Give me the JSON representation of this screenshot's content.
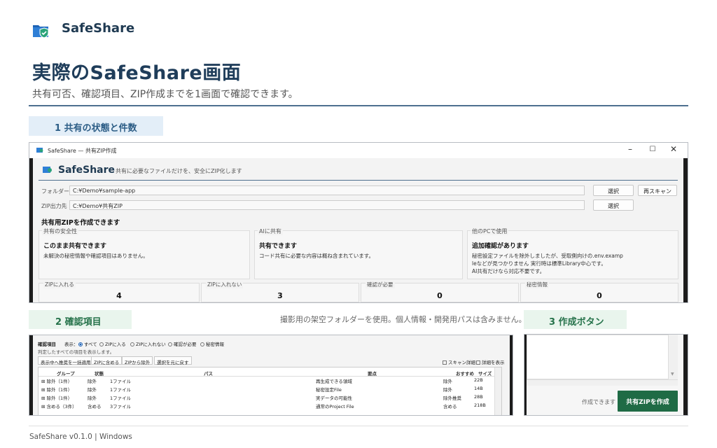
{
  "header": {
    "brand": "SafeShare",
    "title": "実際のSafeShare画面",
    "subtitle": "共有可否、確認項目、ZIP作成までを1画面で確認できます。"
  },
  "sections": {
    "s1": "1  共有の状態と件数",
    "s2": "2  確認項目",
    "s3": "3  作成ボタン",
    "note": "撮影用の架空フォルダーを使用。個人情報・開発用パスは含みません。"
  },
  "window": {
    "title": "SafeShare — 共有ZIP作成",
    "minimize": "–",
    "maximize": "☐",
    "close": "✕"
  },
  "app": {
    "name": "SafeShare",
    "tagline": "共有に必要なファイルだけを、安全にZIP化します",
    "folder_label": "フォルダー",
    "folder_value": "C:¥Demo¥sample-app",
    "output_label": "ZIP出力先",
    "output_value": "C:¥Demo¥共有ZIP",
    "select_label": "選択",
    "select2_label": "選択",
    "rescan_label": "再スキャン",
    "status_heading": "共有用ZIPを作成できます"
  },
  "cards": [
    {
      "header": "共有の安全性",
      "title": "このまま共有できます",
      "desc": "未解決の秘密情報や確認項目はありません。"
    },
    {
      "header": "AIに共有",
      "title": "共有できます",
      "desc": "コード共有に必要な内容は概ね含まれています。"
    },
    {
      "header": "他のPCで使用",
      "title": "追加確認があります",
      "desc": "秘密設定ファイルを除外しましたが、受取側向けの.env.examp\nleなどが見つかりません 実行時は標準Library中心です。\nAI共有だけなら対応不要です。"
    }
  ],
  "stats": [
    {
      "label": "ZIPに入れる",
      "value": "4"
    },
    {
      "label": "ZIPに入れない",
      "value": "3"
    },
    {
      "label": "確認が必要",
      "value": "0"
    },
    {
      "label": "秘密情報",
      "value": "0"
    }
  ],
  "check": {
    "title": "確認項目",
    "display_label": "表示：",
    "filters": [
      "すべて",
      "ZIPに入る",
      "ZIPに入れない",
      "確認が必要",
      "秘密情報"
    ],
    "filter_selected": "すべて",
    "hint": "判定したすべての項目を表示します。",
    "buttons": [
      "表示中へ推奨を一括適用",
      "ZIPに含める",
      "ZIPから除外",
      "選択を元に戻す"
    ],
    "scan_detail": "スキャン詳細",
    "show_detail": "詳細を表示",
    "columns": [
      "グループ",
      "状態",
      "パス",
      "要点",
      "おすすめ",
      "サイズ"
    ],
    "rows": [
      [
        "⊞ 除外（1件）",
        "除外",
        "1ファイル",
        "再生成できる領域",
        "除外",
        "22B"
      ],
      [
        "⊞ 除外（1件）",
        "除外",
        "1ファイル",
        "秘密設定File",
        "除外",
        "14B"
      ],
      [
        "⊞ 除外（1件）",
        "除外",
        "1ファイル",
        "実データの可能性",
        "除外推奨",
        "28B"
      ],
      [
        "⊞ 含める（3件）",
        "含める",
        "3ファイル",
        "通常のProject File",
        "含める",
        "218B"
      ]
    ]
  },
  "create": {
    "ready": "作成できます",
    "button": "共有ZIPを作成",
    "scroll_down": "▼"
  },
  "footer": "SafeShare v0.1.0  |  Windows",
  "colors": {
    "accent": "#1f3d5a",
    "primary_button": "#1f6b45",
    "section_blue": "#e3eef8",
    "section_green": "#e9f5ed"
  }
}
